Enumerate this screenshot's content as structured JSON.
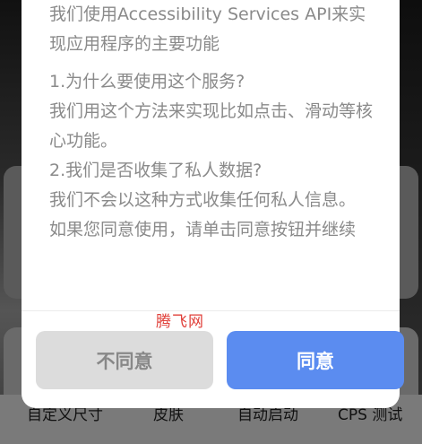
{
  "dialog": {
    "intro": "我们使用Accessibility Services API来实现应用程序的主要功能",
    "q1": "1.为什么要使用这个服务?",
    "a1": "我们用这个方法来实现比如点击、滑动等核心功能。",
    "q2": "2.我们是否收集了私人数据?",
    "a2": "我们不会以这种方式收集任何私人信息。",
    "prompt": "如果您同意使用，请单击同意按钮并继续",
    "decline_label": "不同意",
    "accept_label": "同意"
  },
  "watermark": "腾飞网",
  "background": {
    "bottom_tabs": [
      "自定义尺寸",
      "皮肤",
      "自动启动",
      "CPS 测试"
    ]
  },
  "colors": {
    "accept": "#5b8cf0",
    "decline": "#dcdcdc",
    "body_text": "#8a8a8a",
    "watermark": "#e0403a"
  }
}
